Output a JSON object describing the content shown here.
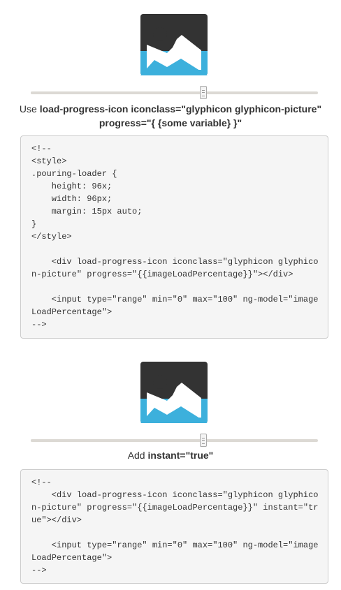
{
  "colors": {
    "loader_frame": "#333333",
    "loader_fill": "#3cb0dc",
    "slider_track": "#dcd9d4",
    "code_background": "#f5f5f5",
    "code_border": "#cccccc"
  },
  "demo1": {
    "icon": "picture-icon",
    "progress": 0.6,
    "caption_prefix": "Use ",
    "caption_code": "load-progress-icon iconclass=\"glyphicon glyphicon-picture\" progress=\"{ {some variable} }\"",
    "code": "<!--\n<style>\n.pouring-loader {\n    height: 96x;\n    width: 96px;\n    margin: 15px auto;\n}\n</style>\n\n    <div load-progress-icon iconclass=\"glyphicon glyphico\nn-picture\" progress=\"{{imageLoadPercentage}}\"></div>\n\n    <input type=\"range\" min=\"0\" max=\"100\" ng-model=\"image\nLoadPercentage\">\n-->"
  },
  "demo2": {
    "icon": "picture-icon",
    "progress": 0.6,
    "caption_prefix": "Add ",
    "caption_code": "instant=\"true\"",
    "code": "<!--\n    <div load-progress-icon iconclass=\"glyphicon glyphico\nn-picture\" progress=\"{{imageLoadPercentage}}\" instant=\"tr\nue\"></div>\n\n    <input type=\"range\" min=\"0\" max=\"100\" ng-model=\"image\nLoadPercentage\">\n-->"
  }
}
